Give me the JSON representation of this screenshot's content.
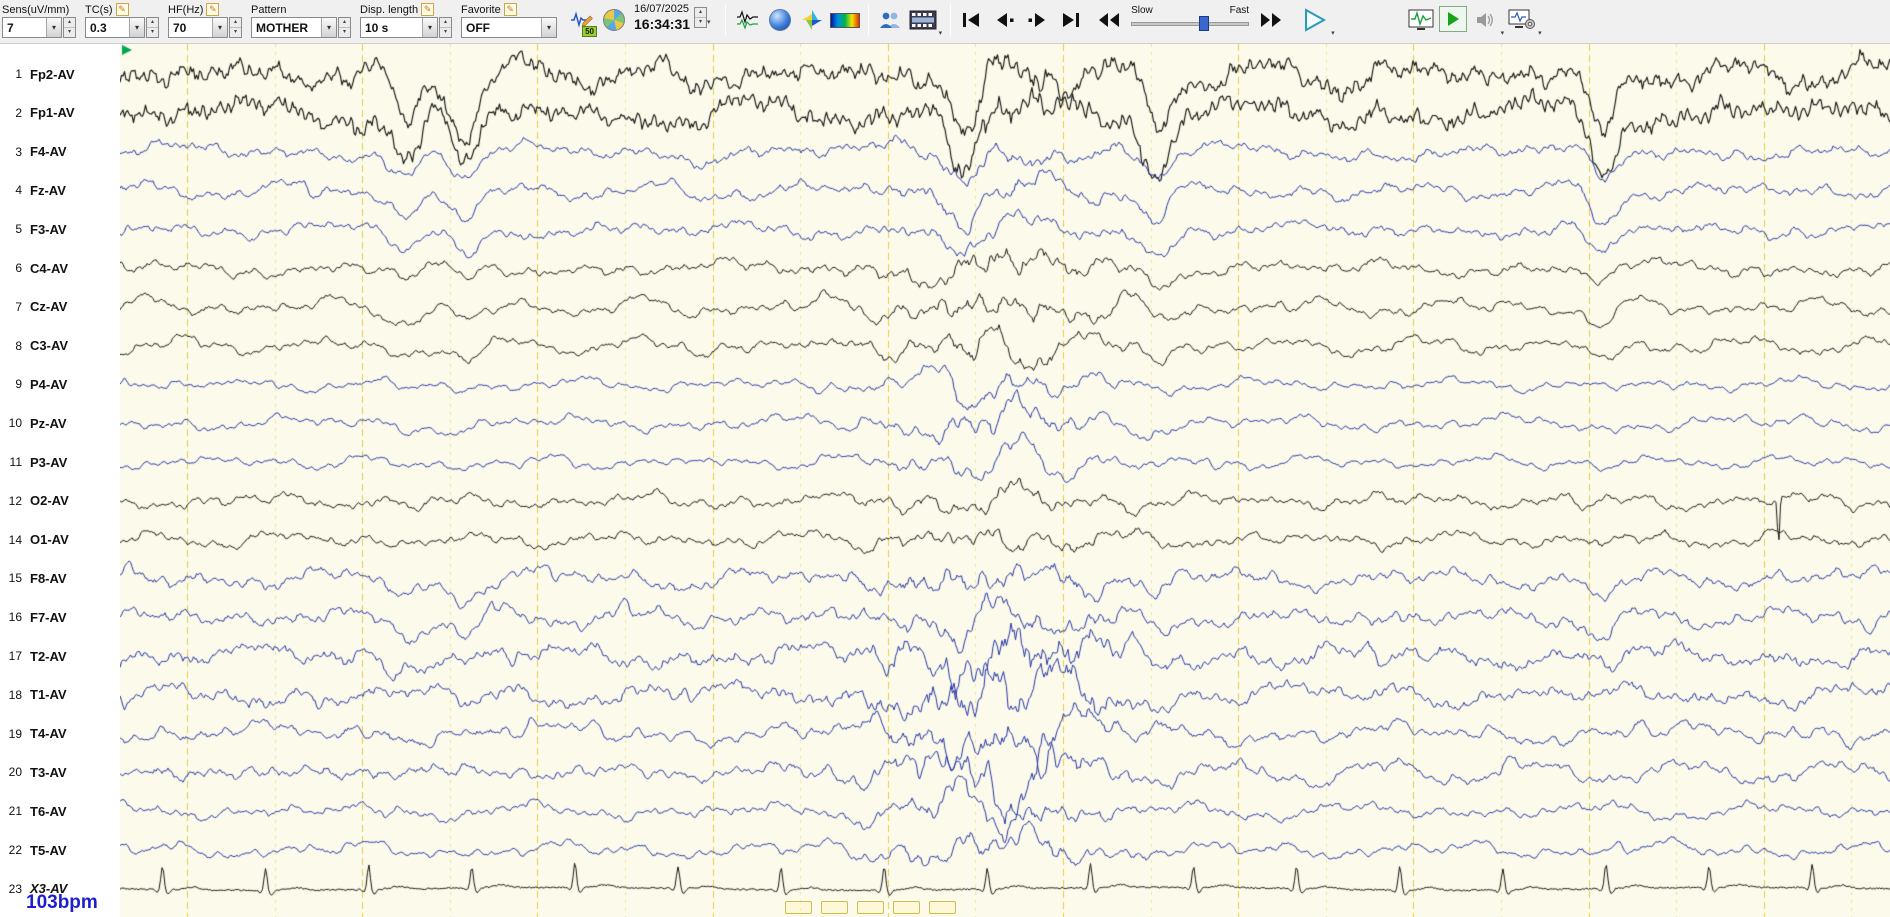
{
  "toolbar": {
    "groups": [
      {
        "label": "Sens(uV/mm)",
        "value": "7",
        "pencil": false,
        "spinner": true
      },
      {
        "label": "TC(s)",
        "value": "0.3",
        "pencil": true,
        "spinner": true
      },
      {
        "label": "HF(Hz)",
        "value": "70",
        "pencil": true,
        "spinner": true
      },
      {
        "label": "Pattern",
        "value": "MOTHER",
        "pencil": false,
        "spinner": true
      },
      {
        "label": "Disp. length",
        "value": "10 s",
        "pencil": true,
        "spinner": true
      },
      {
        "label": "Favorite",
        "value": "OFF",
        "pencil": true,
        "spinner": false
      }
    ],
    "notch_label": "50",
    "date": "16/07/2025",
    "time": "16:34:31",
    "slow_label": "Slow",
    "fast_label": "Fast"
  },
  "display": {
    "seconds_per_page": 10,
    "background": "#FCFBEB",
    "grid_color": "#E3C93F",
    "trace_black": "#161616",
    "trace_blue": "#2636A6",
    "heart_rate": "103bpm",
    "heart_rate_color": "#1E1ECF",
    "burst": {
      "t": 4.95,
      "w": 0.6
    },
    "blinks": [
      {
        "t": 1.62,
        "d": 50
      },
      {
        "t": 1.95,
        "d": 58
      },
      {
        "t": 4.77,
        "d": 62
      },
      {
        "t": 5.86,
        "d": 55
      },
      {
        "t": 8.38,
        "d": 60
      },
      {
        "t": 3.25,
        "d": 15
      },
      {
        "t": 6.9,
        "d": 13
      }
    ]
  },
  "channels": [
    {
      "num": "1",
      "label": "Fp2-AV",
      "color": "black",
      "amp": 9,
      "slow": 1.2,
      "fast": 2.4,
      "blink": 1.0,
      "burst": 0.2
    },
    {
      "num": "2",
      "label": "Fp1-AV",
      "color": "black",
      "amp": 9,
      "slow": 1.2,
      "fast": 2.4,
      "blink": 0.95,
      "burst": 0.2
    },
    {
      "num": "3",
      "label": "F4-AV",
      "color": "blue",
      "amp": 6,
      "slow": 1.0,
      "fast": 1.2,
      "blink": 0.5,
      "burst": 0.35
    },
    {
      "num": "4",
      "label": "Fz-AV",
      "color": "blue",
      "amp": 6.5,
      "slow": 1.0,
      "fast": 1.2,
      "blink": 0.55,
      "burst": 0.4
    },
    {
      "num": "5",
      "label": "F3-AV",
      "color": "blue",
      "amp": 6,
      "slow": 1.0,
      "fast": 1.2,
      "blink": 0.5,
      "burst": 0.35
    },
    {
      "num": "6",
      "label": "C4-AV",
      "color": "black",
      "amp": 6,
      "slow": 1.0,
      "fast": 1.0,
      "blink": 0.22,
      "burst": 0.8
    },
    {
      "num": "7",
      "label": "Cz-AV",
      "color": "black",
      "amp": 6.5,
      "slow": 1.1,
      "fast": 1.0,
      "blink": 0.28,
      "burst": 1.0
    },
    {
      "num": "8",
      "label": "C3-AV",
      "color": "black",
      "amp": 6,
      "slow": 1.0,
      "fast": 1.0,
      "blink": 0.22,
      "burst": 0.8
    },
    {
      "num": "9",
      "label": "P4-AV",
      "color": "blue",
      "amp": 5,
      "slow": 0.9,
      "fast": 0.9,
      "blink": 0.08,
      "burst": 0.9
    },
    {
      "num": "10",
      "label": "Pz-AV",
      "color": "blue",
      "amp": 5.5,
      "slow": 1.0,
      "fast": 0.9,
      "blink": 0.1,
      "burst": 1.0
    },
    {
      "num": "11",
      "label": "P3-AV",
      "color": "blue",
      "amp": 5,
      "slow": 0.9,
      "fast": 0.9,
      "blink": 0.08,
      "burst": 0.9
    },
    {
      "num": "12",
      "label": "O2-AV",
      "color": "black",
      "amp": 6,
      "slow": 0.9,
      "fast": 1.1,
      "blink": 0.05,
      "burst": 0.5,
      "vspike": 9.37
    },
    {
      "num": "14",
      "label": "O1-AV",
      "color": "black",
      "amp": 6,
      "slow": 0.9,
      "fast": 1.1,
      "blink": 0.05,
      "burst": 0.5
    },
    {
      "num": "15",
      "label": "F8-AV",
      "color": "blue",
      "amp": 7,
      "slow": 1.0,
      "fast": 1.3,
      "blink": 0.35,
      "burst": 0.6,
      "spiky": true
    },
    {
      "num": "16",
      "label": "F7-AV",
      "color": "blue",
      "amp": 7,
      "slow": 1.0,
      "fast": 1.3,
      "blink": 0.35,
      "burst": 0.6,
      "spiky": true
    },
    {
      "num": "17",
      "label": "T2-AV",
      "color": "blue",
      "amp": 8,
      "slow": 1.1,
      "fast": 1.3,
      "blink": 0.12,
      "burst": 1.2,
      "spiky": true
    },
    {
      "num": "18",
      "label": "T1-AV",
      "color": "blue",
      "amp": 8,
      "slow": 1.1,
      "fast": 1.3,
      "blink": 0.12,
      "burst": 1.2,
      "spiky": true
    },
    {
      "num": "19",
      "label": "T4-AV",
      "color": "blue",
      "amp": 7,
      "slow": 1.1,
      "fast": 1.2,
      "blink": 0,
      "burst": 1.3,
      "spiky": true
    },
    {
      "num": "20",
      "label": "T3-AV",
      "color": "blue",
      "amp": 7,
      "slow": 1.1,
      "fast": 1.2,
      "blink": 0,
      "burst": 1.3,
      "spiky": true
    },
    {
      "num": "21",
      "label": "T6-AV",
      "color": "blue",
      "amp": 6,
      "slow": 1.0,
      "fast": 1.0,
      "blink": 0,
      "burst": 1.0
    },
    {
      "num": "22",
      "label": "T5-AV",
      "color": "blue",
      "amp": 6,
      "slow": 1.0,
      "fast": 1.0,
      "blink": 0,
      "burst": 1.0
    },
    {
      "num": "23",
      "label": "X3-AV",
      "color": "black",
      "italic": true,
      "type": "ecg",
      "bpm": 103
    }
  ]
}
